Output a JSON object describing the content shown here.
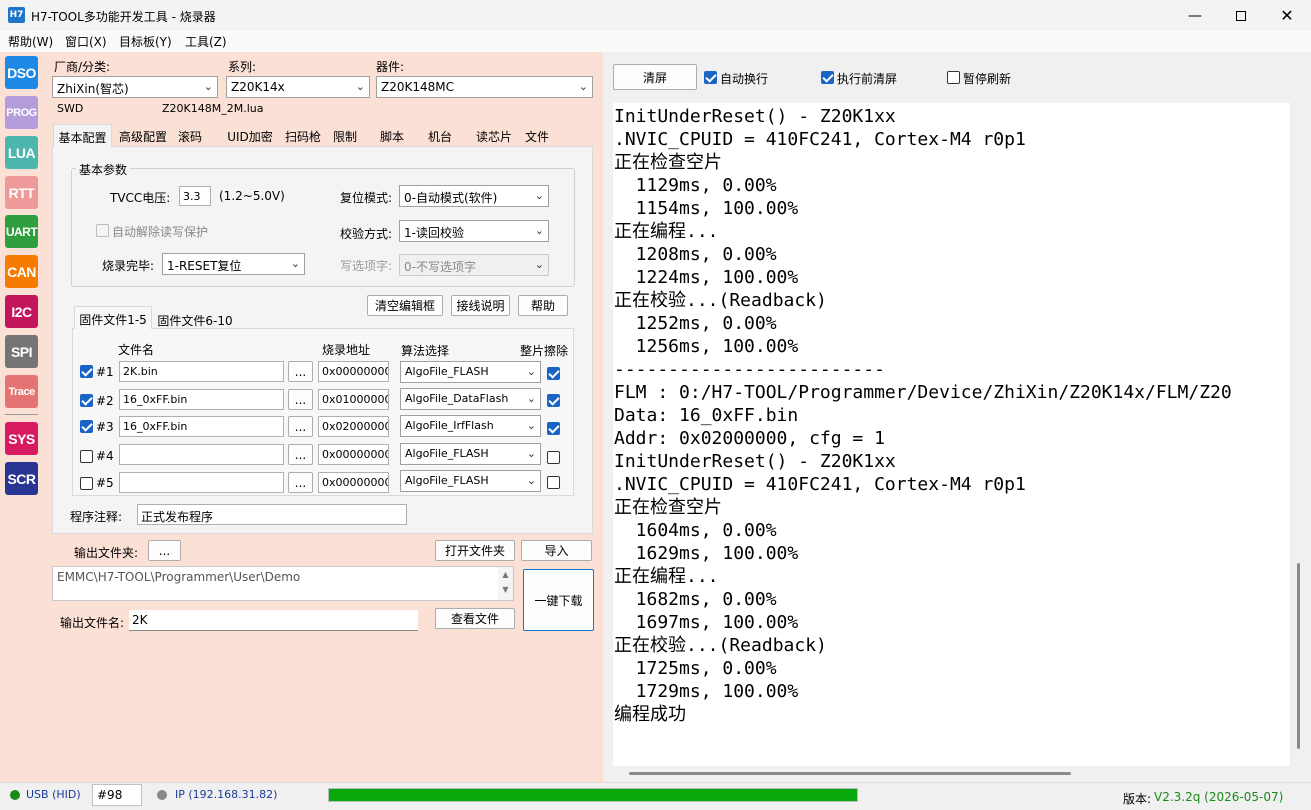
{
  "window": {
    "title": "H7-TOOL多功能开发工具 - 烧录器",
    "icon_label": "H7"
  },
  "menu": [
    "帮助(W)",
    "窗口(X)",
    "目标板(Y)",
    "工具(Z)"
  ],
  "sidebar": [
    {
      "label": "DSO",
      "color": "#1e88e5"
    },
    {
      "label": "PROG",
      "color": "#b39ddb"
    },
    {
      "label": "LUA",
      "color": "#4db6ac"
    },
    {
      "label": "RTT",
      "color": "#ef9a9a"
    },
    {
      "label": "UART",
      "color": "#2e9e3e"
    },
    {
      "label": "CAN",
      "color": "#f57c00"
    },
    {
      "label": "I2C",
      "color": "#c2185b"
    },
    {
      "label": "SPI",
      "color": "#757575"
    },
    {
      "label": "Trace",
      "color": "#e57373"
    },
    {
      "label": "SYS",
      "color": "#d81b60"
    },
    {
      "label": "SCR",
      "color": "#283593"
    }
  ],
  "device": {
    "vendor_label": "厂商/分类:",
    "vendor_value": "ZhiXin(智芯)",
    "series_label": "系列:",
    "series_value": "Z20K14x",
    "part_label": "器件:",
    "part_value": "Z20K148MC",
    "interface": "SWD",
    "lua_file": "Z20K148M_2M.lua"
  },
  "tabs": [
    "基本配置",
    "高级配置",
    "滚码",
    "UID加密",
    "扫码枪",
    "限制",
    "脚本",
    "机台",
    "读芯片",
    "文件"
  ],
  "basic": {
    "group_title": "基本参数",
    "tvcc_label": "TVCC电压:",
    "tvcc_value": "3.3",
    "tvcc_range": "(1.2~5.0V)",
    "reset_label": "复位模式:",
    "reset_value": "0-自动模式(软件)",
    "unlock_label": "自动解除读写保护",
    "verify_label": "校验方式:",
    "verify_value": "1-读回校验",
    "done_label": "烧录完毕:",
    "done_value": "1-RESET复位",
    "optbyte_label": "写选项字:",
    "optbyte_value": "0-不写选项字"
  },
  "buttons": {
    "clear_editor": "清空编辑框",
    "wiring": "接线说明",
    "help": "帮助",
    "browse": "...",
    "open_folder": "打开文件夹",
    "import": "导入",
    "one_key": "一键下载",
    "view_file": "查看文件",
    "clear_log": "清屏"
  },
  "fw_tabs": [
    "固件文件1-5",
    "固件文件6-10"
  ],
  "fw_headers": {
    "name": "文件名",
    "addr": "烧录地址",
    "algo": "算法选择",
    "erase": "整片擦除"
  },
  "fw_rows": [
    {
      "idx": "#1",
      "checked": true,
      "file": "2K.bin",
      "browse": "...",
      "addr": "0x00000000",
      "algo": "AlgoFile_FLASH",
      "erase": true
    },
    {
      "idx": "#2",
      "checked": true,
      "file": "16_0xFF.bin",
      "browse": "...",
      "addr": "0x01000000",
      "algo": "AlgoFile_DataFlash",
      "erase": true
    },
    {
      "idx": "#3",
      "checked": true,
      "file": "16_0xFF.bin",
      "browse": "...",
      "addr": "0x02000000",
      "algo": "AlgoFile_IrfFlash",
      "erase": true
    },
    {
      "idx": "#4",
      "checked": false,
      "file": "",
      "browse": "...",
      "addr": "0x00000000",
      "algo": "AlgoFile_FLASH",
      "erase": false
    },
    {
      "idx": "#5",
      "checked": false,
      "file": "",
      "browse": "...",
      "addr": "0x00000000",
      "algo": "AlgoFile_FLASH",
      "erase": false
    }
  ],
  "comment": {
    "label": "程序注释:",
    "value": "正式发布程序"
  },
  "output": {
    "folder_label": "输出文件夹:",
    "folder_path": "EMMC\\H7-TOOL\\Programmer\\User\\Demo",
    "name_label": "输出文件名:",
    "name_value": "2K"
  },
  "log_options": {
    "auto_wrap": "自动换行",
    "clear_before": "执行前清屏",
    "pause_refresh": "暂停刷新"
  },
  "log_lines": [
    "InitUnderReset() - Z20K1xx",
    ".NVIC_CPUID = 410FC241, Cortex-M4 r0p1",
    "正在检查空片",
    "  1129ms, 0.00%",
    "  1154ms, 100.00%",
    "正在编程...",
    "  1208ms, 0.00%",
    "  1224ms, 100.00%",
    "正在校验...(Readback)",
    "  1252ms, 0.00%",
    "  1256ms, 100.00%",
    "-------------------------",
    "FLM : 0:/H7-TOOL/Programmer/Device/ZhiXin/Z20K14x/FLM/Z20",
    "Data: 16_0xFF.bin",
    "Addr: 0x02000000, cfg = 1",
    "InitUnderReset() - Z20K1xx",
    ".NVIC_CPUID = 410FC241, Cortex-M4 r0p1",
    "正在检查空片",
    "  1604ms, 0.00%",
    "  1629ms, 100.00%",
    "正在编程...",
    "  1682ms, 0.00%",
    "  1697ms, 100.00%",
    "正在校验...(Readback)",
    "  1725ms, 0.00%",
    "  1729ms, 100.00%",
    "编程成功"
  ],
  "status": {
    "usb": "USB (HID)",
    "port": "#98",
    "ip": "IP (192.168.31.82)",
    "version_label": "版本:",
    "version": "V2.3.2q (2026-05-07)",
    "progress": 1.0
  }
}
